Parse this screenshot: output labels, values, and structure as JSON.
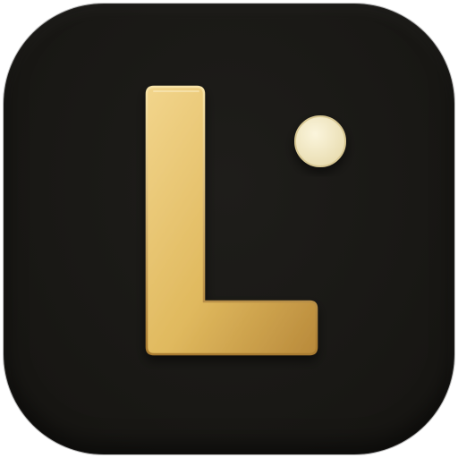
{
  "icon": {
    "type": "app-icon",
    "glyph_icon": "letter-l-icon",
    "dot_icon": "dot-icon",
    "colors": {
      "background": "#1a1916",
      "glyph_light": "#f2d58c",
      "glyph_mid": "#e0b95e",
      "glyph_dark": "#b8893a",
      "dot_light": "#fbf5dc",
      "dot_dark": "#e8dcb0"
    }
  }
}
